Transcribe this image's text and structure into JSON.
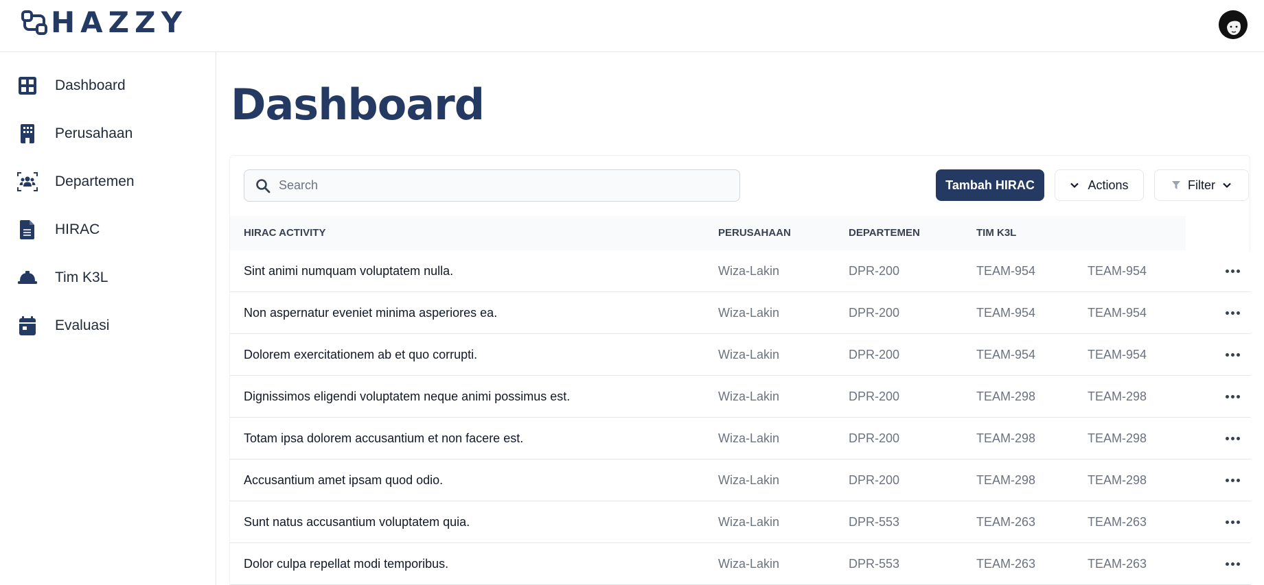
{
  "brand": {
    "name": "HAZZY",
    "accent": "#243a63"
  },
  "sidebar": {
    "items": [
      {
        "label": "Dashboard",
        "icon": "grid-icon"
      },
      {
        "label": "Perusahaan",
        "icon": "building-icon"
      },
      {
        "label": "Departemen",
        "icon": "users-group-icon"
      },
      {
        "label": "HIRAC",
        "icon": "document-icon"
      },
      {
        "label": "Tim K3L",
        "icon": "helmet-icon"
      },
      {
        "label": "Evaluasi",
        "icon": "calendar-icon"
      }
    ]
  },
  "main": {
    "title": "Dashboard",
    "search": {
      "placeholder": "Search",
      "value": ""
    },
    "buttons": {
      "add": "Tambah HIRAC",
      "actions": "Actions",
      "filter": "Filter"
    },
    "table": {
      "headers": [
        "HIRAC ACTIVITY",
        "PERUSAHAAN",
        "DEPARTEMEN",
        "TIM K3L"
      ],
      "rows": [
        [
          "Sint animi numquam voluptatem nulla.",
          "Wiza-Lakin",
          "DPR-200",
          "TEAM-954",
          "TEAM-954"
        ],
        [
          "Non aspernatur eveniet minima asperiores ea.",
          "Wiza-Lakin",
          "DPR-200",
          "TEAM-954",
          "TEAM-954"
        ],
        [
          "Dolorem exercitationem ab et quo corrupti.",
          "Wiza-Lakin",
          "DPR-200",
          "TEAM-954",
          "TEAM-954"
        ],
        [
          "Dignissimos eligendi voluptatem neque animi possimus est.",
          "Wiza-Lakin",
          "DPR-200",
          "TEAM-298",
          "TEAM-298"
        ],
        [
          "Totam ipsa dolorem accusantium et non facere est.",
          "Wiza-Lakin",
          "DPR-200",
          "TEAM-298",
          "TEAM-298"
        ],
        [
          "Accusantium amet ipsam quod odio.",
          "Wiza-Lakin",
          "DPR-200",
          "TEAM-298",
          "TEAM-298"
        ],
        [
          "Sunt natus accusantium voluptatem quia.",
          "Wiza-Lakin",
          "DPR-553",
          "TEAM-263",
          "TEAM-263"
        ],
        [
          "Dolor culpa repellat modi temporibus.",
          "Wiza-Lakin",
          "DPR-553",
          "TEAM-263",
          "TEAM-263"
        ]
      ]
    }
  }
}
